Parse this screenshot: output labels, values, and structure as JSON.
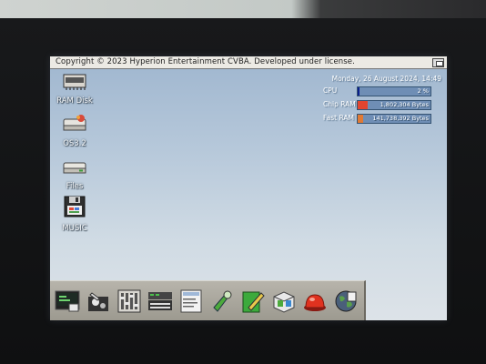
{
  "screen": {
    "title": "Copyright © 2023 Hyperion Entertainment CVBA. Developed under license."
  },
  "desktop_icons": [
    {
      "label": "RAM Disk",
      "icon": "ram-disk-icon"
    },
    {
      "label": "OS3.2",
      "icon": "harddisk-icon"
    },
    {
      "label": "Files",
      "icon": "drive-icon"
    },
    {
      "label": "MUSIC",
      "icon": "floppy-icon"
    }
  ],
  "monitor": {
    "datetime": "Monday, 26 August 2024, 14:49",
    "cpu": {
      "label": "CPU",
      "value": "2 %",
      "level_percent": 2,
      "color": "#0a1f8c"
    },
    "chip_ram": {
      "label": "Chip RAM",
      "value": "1,802,304 Bytes",
      "level_percent": 14,
      "color": "#e2452f"
    },
    "fast_ram": {
      "label": "Fast RAM",
      "value": "141,738,392 Bytes",
      "level_percent": 8,
      "color": "#e07a35"
    }
  },
  "dock": {
    "items": [
      {
        "name": "shell-icon"
      },
      {
        "name": "paint-icon"
      },
      {
        "name": "mixer-icon"
      },
      {
        "name": "synth-icon"
      },
      {
        "name": "document-icon"
      },
      {
        "name": "tools-icon"
      },
      {
        "name": "pen-icon"
      },
      {
        "name": "package-icon"
      },
      {
        "name": "alarm-icon"
      },
      {
        "name": "globe-icon"
      }
    ]
  }
}
